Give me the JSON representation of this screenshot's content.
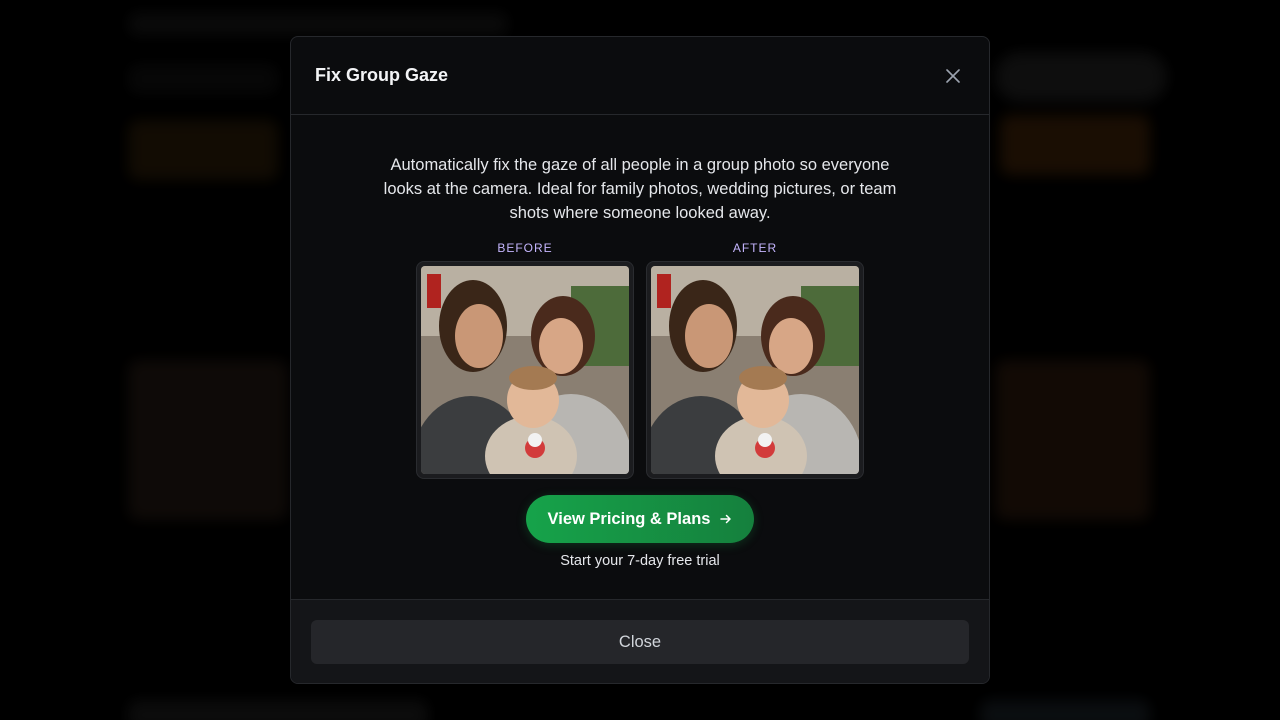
{
  "modal": {
    "title": "Fix Group Gaze",
    "description": "Automatically fix the gaze of all people in a group photo so everyone looks at the camera. Ideal for family photos, wedding pictures, or team shots where someone looked away.",
    "before_label": "BEFORE",
    "after_label": "AFTER",
    "cta_label": "View Pricing & Plans",
    "cta_icon": "arrow-right-icon",
    "trial_text": "Start your 7-day free trial",
    "close_label": "Close",
    "close_icon": "close-icon"
  },
  "colors": {
    "accent_green": "#16a34a",
    "label_purple": "#c4b5fd",
    "modal_bg": "#0b0c0e"
  }
}
